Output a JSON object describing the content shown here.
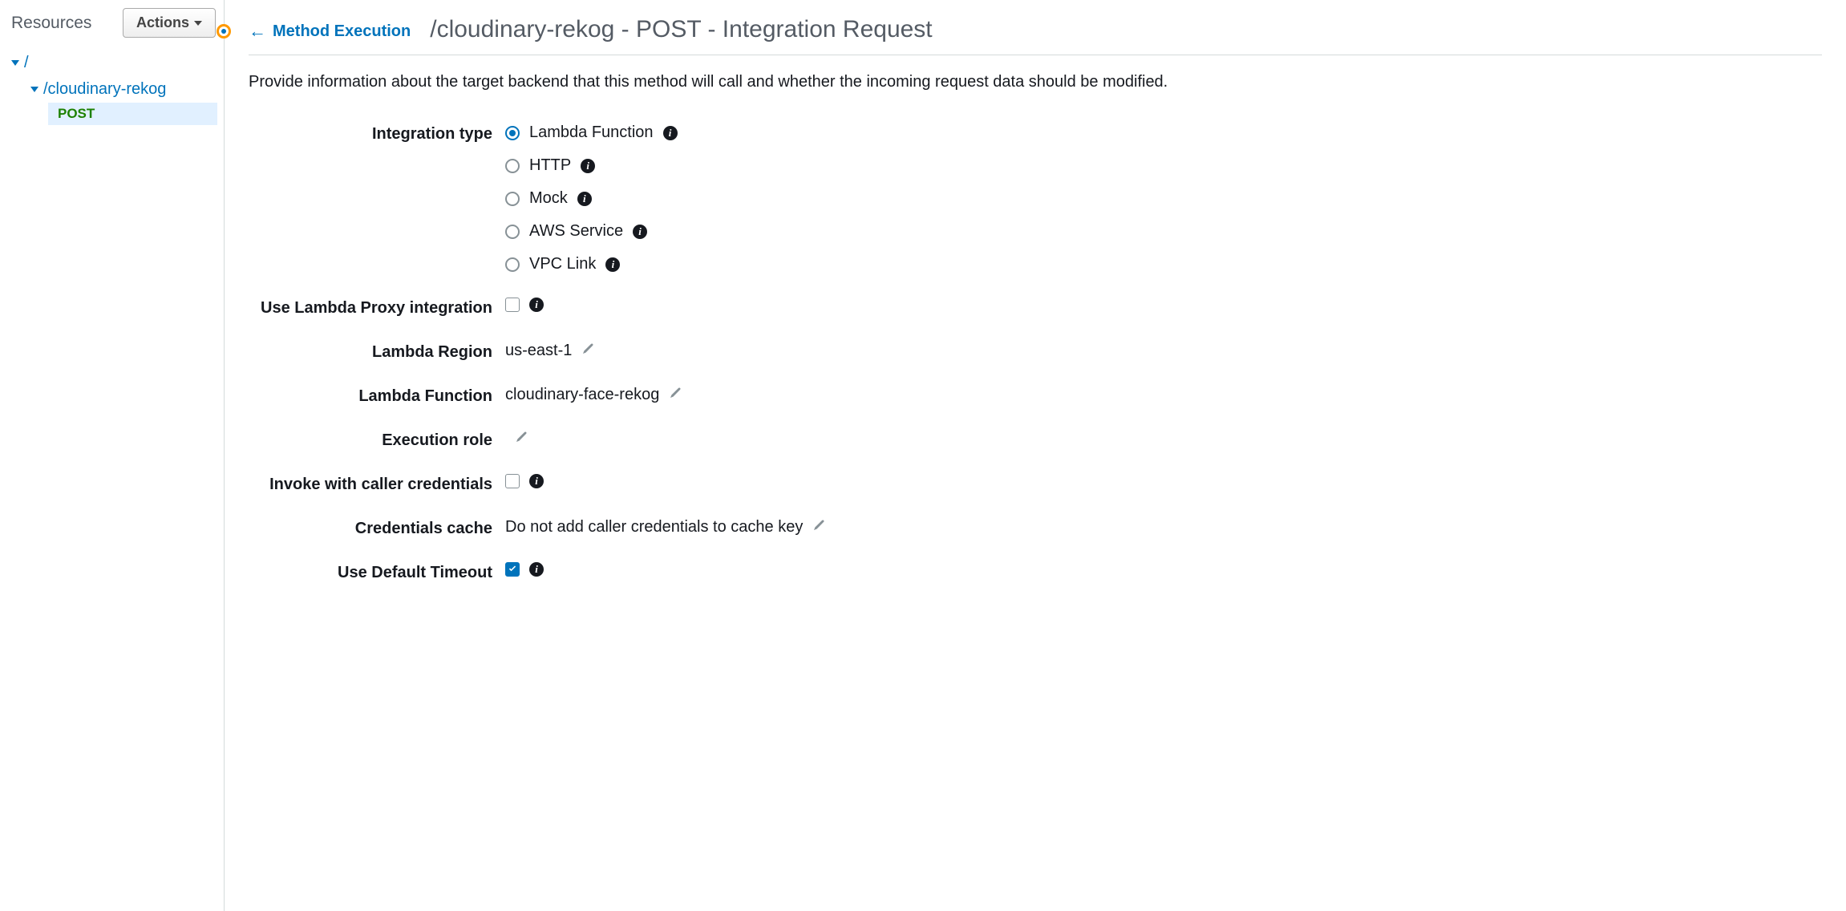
{
  "sidebar": {
    "title": "Resources",
    "actions_label": "Actions",
    "tree": {
      "root": "/",
      "child": "/cloudinary-rekog",
      "method": "POST"
    }
  },
  "header": {
    "back_label": "Method Execution",
    "title": "/cloudinary-rekog - POST - Integration Request"
  },
  "description": "Provide information about the target backend that this method will call and whether the incoming request data should be modified.",
  "form": {
    "integration_type": {
      "label": "Integration type",
      "options": [
        {
          "label": "Lambda Function",
          "selected": true
        },
        {
          "label": "HTTP",
          "selected": false
        },
        {
          "label": "Mock",
          "selected": false
        },
        {
          "label": "AWS Service",
          "selected": false
        },
        {
          "label": "VPC Link",
          "selected": false
        }
      ]
    },
    "lambda_proxy": {
      "label": "Use Lambda Proxy integration",
      "checked": false
    },
    "lambda_region": {
      "label": "Lambda Region",
      "value": "us-east-1"
    },
    "lambda_function": {
      "label": "Lambda Function",
      "value": "cloudinary-face-rekog"
    },
    "execution_role": {
      "label": "Execution role",
      "value": ""
    },
    "invoke_caller": {
      "label": "Invoke with caller credentials",
      "checked": false
    },
    "credentials_cache": {
      "label": "Credentials cache",
      "value": "Do not add caller credentials to cache key"
    },
    "default_timeout": {
      "label": "Use Default Timeout",
      "checked": true
    }
  }
}
